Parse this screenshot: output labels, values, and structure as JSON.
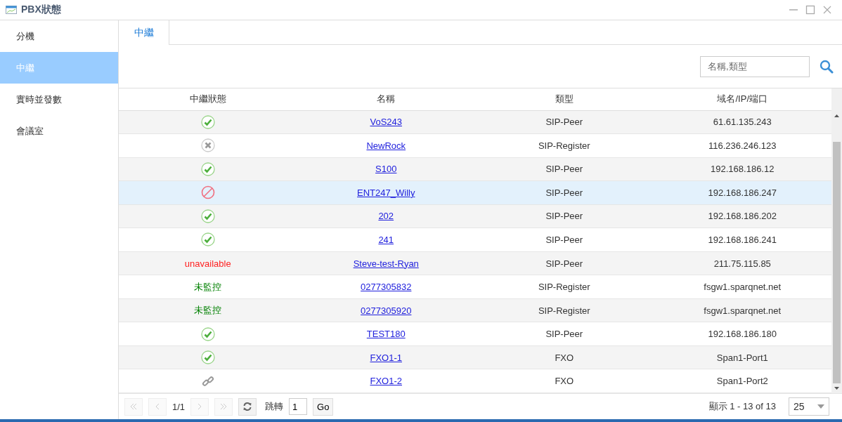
{
  "window": {
    "title": "PBX狀態"
  },
  "sidebar": {
    "items": [
      {
        "label": "分機",
        "selected": false
      },
      {
        "label": "中繼",
        "selected": true
      },
      {
        "label": "實時並發數",
        "selected": false
      },
      {
        "label": "會議室",
        "selected": false
      }
    ]
  },
  "tabs": [
    {
      "label": "中繼",
      "selected": true
    }
  ],
  "search": {
    "placeholder": "名稱,類型"
  },
  "table": {
    "columns": [
      "中繼狀態",
      "名稱",
      "類型",
      "域名/IP/端口"
    ],
    "rows": [
      {
        "status": {
          "kind": "ok"
        },
        "name": "VoS243",
        "type": "SIP-Peer",
        "address": "61.61.135.243",
        "selected": false
      },
      {
        "status": {
          "kind": "offline"
        },
        "name": "NewRock",
        "type": "SIP-Register",
        "address": "116.236.246.123",
        "selected": false
      },
      {
        "status": {
          "kind": "ok"
        },
        "name": "S100",
        "type": "SIP-Peer",
        "address": "192.168.186.12",
        "selected": false
      },
      {
        "status": {
          "kind": "blocked"
        },
        "name": "ENT247_Willy",
        "type": "SIP-Peer",
        "address": "192.168.186.247",
        "selected": true
      },
      {
        "status": {
          "kind": "ok"
        },
        "name": "202",
        "type": "SIP-Peer",
        "address": "192.168.186.202",
        "selected": false
      },
      {
        "status": {
          "kind": "ok"
        },
        "name": "241",
        "type": "SIP-Peer",
        "address": "192.168.186.241",
        "selected": false
      },
      {
        "status": {
          "kind": "text",
          "text": "unavailable",
          "color": "#ff2020"
        },
        "name": "Steve-test-Ryan",
        "type": "SIP-Peer",
        "address": "211.75.115.85",
        "selected": false
      },
      {
        "status": {
          "kind": "text",
          "text": "未監控",
          "color": "#008000"
        },
        "name": "0277305832",
        "type": "SIP-Register",
        "address": "fsgw1.sparqnet.net",
        "selected": false
      },
      {
        "status": {
          "kind": "text",
          "text": "未監控",
          "color": "#008000"
        },
        "name": "0277305920",
        "type": "SIP-Register",
        "address": "fsgw1.sparqnet.net",
        "selected": false
      },
      {
        "status": {
          "kind": "ok"
        },
        "name": "TEST180",
        "type": "SIP-Peer",
        "address": "192.168.186.180",
        "selected": false
      },
      {
        "status": {
          "kind": "ok"
        },
        "name": "FXO1-1",
        "type": "FXO",
        "address": "Span1-Port1",
        "selected": false
      },
      {
        "status": {
          "kind": "link"
        },
        "name": "FXO1-2",
        "type": "FXO",
        "address": "Span1-Port2",
        "selected": false
      }
    ]
  },
  "pager": {
    "page": "1/1",
    "jump_label": "跳轉",
    "jump_value": "1",
    "go": "Go",
    "summary": "顯示 1 - 13 of 13",
    "page_size": "25"
  }
}
